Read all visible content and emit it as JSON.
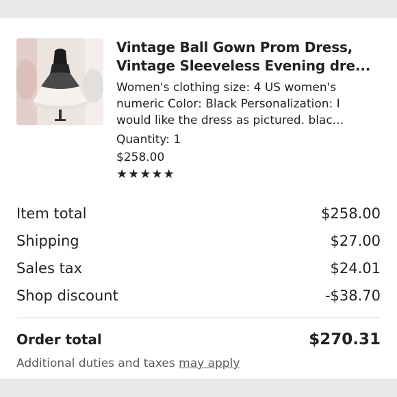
{
  "product": {
    "title_line1": "Vintage Ball Gown Prom Dress,",
    "title_line2": "Vintage Sleeveless Evening dre...",
    "desc_line1": "Women's clothing size: 4 US women's",
    "desc_line2": "numeric Color: Black Personalization: I",
    "desc_line3": "would like the dress as pictured. blac...",
    "quantity": "Quantity: 1",
    "price": "$258.00",
    "rating_stars": 5,
    "image_icon": "dress-photo"
  },
  "summary": {
    "rows": [
      {
        "label": "Item total",
        "value": "$258.00"
      },
      {
        "label": "Shipping",
        "value": "$27.00"
      },
      {
        "label": "Sales tax",
        "value": "$24.01"
      },
      {
        "label": "Shop discount",
        "value": "-$38.70"
      }
    ],
    "order_total_label": "Order total",
    "order_total_value": "$270.31",
    "note_text": "Additional duties and taxes ",
    "note_link": "may apply"
  }
}
